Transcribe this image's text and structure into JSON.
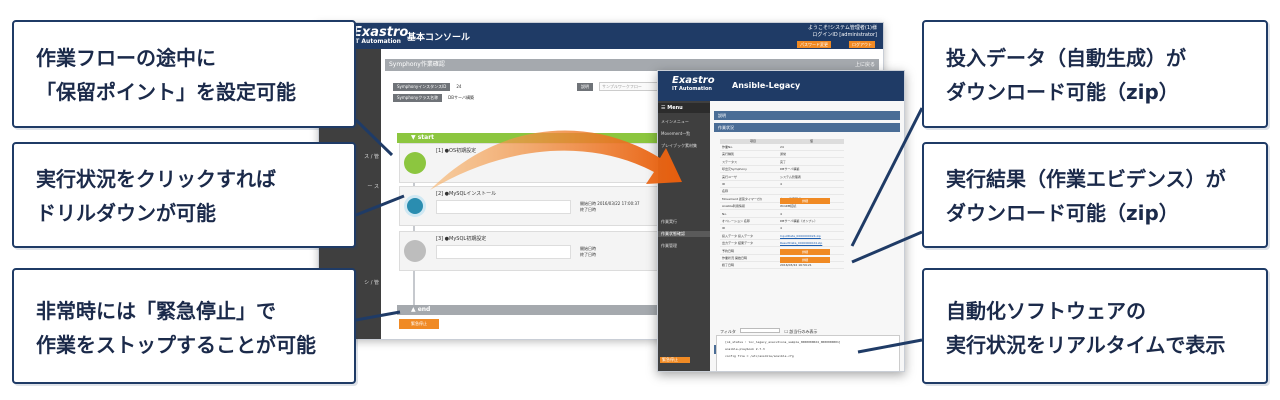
{
  "callouts": {
    "pause_point": [
      "作業フローの途中に",
      "「保留ポイント」を設定可能"
    ],
    "drilldown": [
      "実行状況をクリックすれば",
      "ドリルダウンが可能"
    ],
    "emergency_stop": [
      "非常時には「緊急停止」で",
      "作業をストップすることが可能"
    ],
    "input_data": [
      "投入データ（自動生成）が",
      "ダウンロード可能（zip）"
    ],
    "result_data": [
      "実行結果（作業エビデンス）が",
      "ダウンロード可能（zip）"
    ],
    "realtime": [
      "自動化ソフトウェアの",
      "実行状況をリアルタイムで表示"
    ]
  },
  "console": {
    "logo": "Exastro",
    "logo_sub": "IT Automation",
    "title": "基本コンソール",
    "user_line1": "ようこそ!システム管理者(1)様",
    "user_line2": "ログインID [administrator]",
    "btn_password": "パスワード変更",
    "btn_logout": "ログアウト",
    "menu_items": [
      "メインメニュー",
      "",
      "ス / 管",
      "ー ス",
      "",
      "",
      "シ / 管"
    ],
    "page_title": "Symphony作業確認",
    "back_link": "上に戻る",
    "instance_id_label": "SymphonyインスタンスID",
    "instance_id_value": "24",
    "class_name_label": "Symphonyクラス名称",
    "class_name_value": "DBサーバ構築",
    "note_label": "説明",
    "note_placeholder": "サンプルワークフロー",
    "start": "start",
    "end": "end",
    "nodes": [
      {
        "label": "[1] ●OS初期設定",
        "info1": "",
        "info2": ""
      },
      {
        "label": "[2] ●MySQLインストール",
        "info1": "開始日時 2016/03/22 17:00:37",
        "info2": "終了日時"
      },
      {
        "label": "[3] ●MySQL初期設定",
        "info1": "開始日時",
        "info2": "終了日時"
      }
    ],
    "emergency_stop_label": "緊急停止"
  },
  "ansible": {
    "logo": "Exastro",
    "logo_sub": "IT Automation",
    "title": "Ansible-Legacy",
    "menu_header": "☰ Menu",
    "menu_items": [
      "メインメニュー",
      "Movement一覧",
      "プレイブック素材集",
      "",
      "",
      "",
      "作業実行",
      "作業状態確認",
      "作業管理"
    ],
    "sections": [
      "説明",
      "作業状況"
    ],
    "table_head": [
      "項目",
      "値"
    ],
    "rows": [
      {
        "k": "作業No.",
        "v": "24"
      },
      {
        "k": "実行種別",
        "v": "通常"
      },
      {
        "k": "ステータス",
        "v": "完了"
      },
      {
        "k": "呼出元Symphony",
        "v": "DBサーバ構築"
      },
      {
        "k": "実行ユーザ",
        "v": "システム管理者"
      },
      {
        "k": "ID",
        "v": "4"
      },
      {
        "k": "名称",
        "v": ""
      },
      {
        "k": "Movement 遅延タイマー(分)",
        "v": "ホスト指定形式 IP"
      },
      {
        "k": "Ansible利用情報",
        "v": "WinRM接続"
      },
      {
        "k": "No.",
        "v": "4"
      },
      {
        "k": "オペレーション 名称",
        "v": "DBサーバ構築（オンプレ）"
      },
      {
        "k": "ID",
        "v": "4"
      },
      {
        "k": "投入データ 投入データ",
        "v": "InputData_0000000024.zip"
      },
      {
        "k": "出力データ 結果データ",
        "v": "ResultData_0000000024.zip"
      },
      {
        "k": "予約日時",
        "v": ""
      },
      {
        "k": "作業状況 開始日時",
        "v": "2016/03/22 16:57:00"
      },
      {
        "k": "終了日時",
        "v": "2016/03/22 16:59:21"
      }
    ],
    "btn_detail": "詳細",
    "log_title": "進行状況(実行ログ)",
    "filter_label": "フィルタ",
    "filter_option": "該当行のみ表示",
    "log_lines": [
      "[ok_status : loc_legacy_executions_sample_0000000024_0000000001]",
      "ansible-playbook 2.7.3",
      "config file = /etc/ansible/ansible.cfg"
    ],
    "emergency_stop_label": "緊急停止"
  },
  "colors": {
    "navy": "#1f3b66",
    "orange": "#f08a24",
    "green": "#8cc63f",
    "teal": "#2a8db0"
  }
}
